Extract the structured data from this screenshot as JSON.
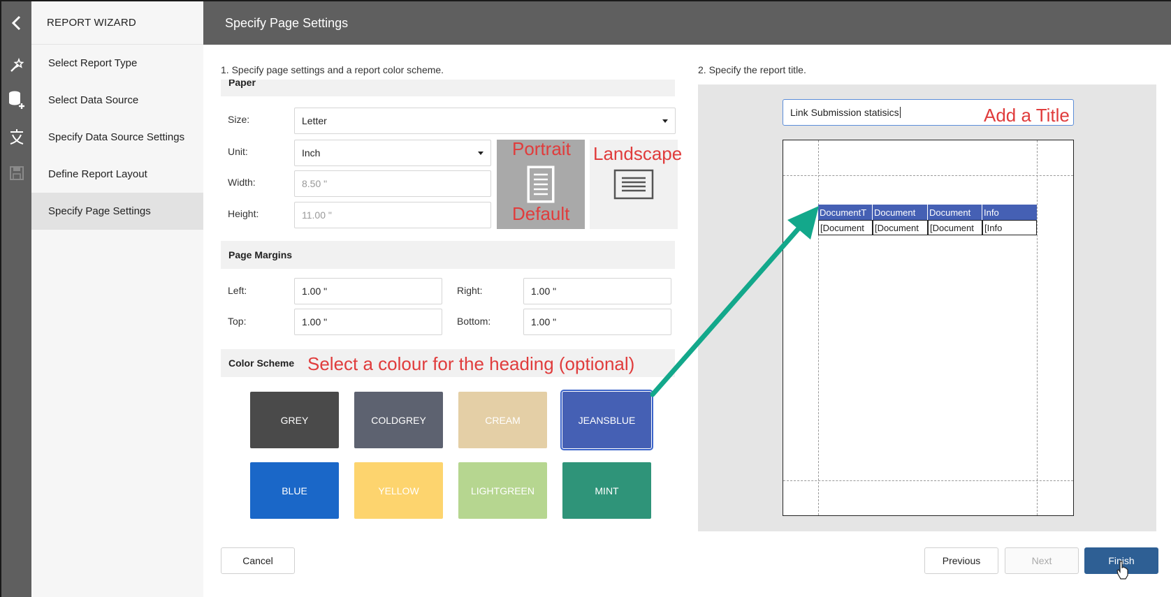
{
  "sidebar": {
    "header": "REPORT WIZARD",
    "items": [
      {
        "label": "Select Report Type"
      },
      {
        "label": "Select Data Source"
      },
      {
        "label": "Specify Data Source Settings"
      },
      {
        "label": "Define Report Layout"
      },
      {
        "label": "Specify Page Settings"
      }
    ]
  },
  "header": {
    "title": "Specify Page Settings"
  },
  "step1": {
    "label": "1. Specify page settings and a report color scheme."
  },
  "step2": {
    "label": "2. Specify the report title."
  },
  "paper": {
    "section_title": "Paper",
    "size_label": "Size:",
    "size_value": "Letter",
    "unit_label": "Unit:",
    "unit_value": "Inch",
    "width_label": "Width:",
    "width_value": "8.50 \"",
    "height_label": "Height:",
    "height_value": "11.00 \""
  },
  "margins": {
    "section_title": "Page Margins",
    "left_label": "Left:",
    "left_value": "1.00 \"",
    "right_label": "Right:",
    "right_value": "1.00 \"",
    "top_label": "Top:",
    "top_value": "1.00 \"",
    "bottom_label": "Bottom:",
    "bottom_value": "1.00 \""
  },
  "color_scheme": {
    "section_title": "Color Scheme",
    "selected": "JEANSBLUE",
    "swatches": [
      {
        "label": "GREY",
        "color": "#4a4a4a"
      },
      {
        "label": "COLDGREY",
        "color": "#5d6270"
      },
      {
        "label": "CREAM",
        "color": "#e4cfa6"
      },
      {
        "label": "JEANSBLUE",
        "color": "#4560b4"
      },
      {
        "label": "BLUE",
        "color": "#1a67c8"
      },
      {
        "label": "YELLOW",
        "color": "#fdd46e"
      },
      {
        "label": "LIGHTGREEN",
        "color": "#b6d690"
      },
      {
        "label": "MINT",
        "color": "#2f9479"
      }
    ]
  },
  "annotations": {
    "portrait": "Portrait",
    "default": "Default",
    "landscape": "Landscape",
    "add_title": "Add a Title",
    "select_colour": "Select a colour for the heading (optional)"
  },
  "report": {
    "title_value": "Link Submission statisics",
    "columns": [
      "DocumentT",
      "Document",
      "Document",
      "Info"
    ],
    "cells": [
      "[Document",
      "[Document",
      "[Document",
      "[Info"
    ]
  },
  "buttons": {
    "cancel": "Cancel",
    "previous": "Previous",
    "next": "Next",
    "finish": "Finish"
  },
  "colors": {
    "accent": "#2e5f94",
    "header_bg": "#5f5f5f",
    "arrow": "#13a88b",
    "annotation": "#e03c3c"
  }
}
